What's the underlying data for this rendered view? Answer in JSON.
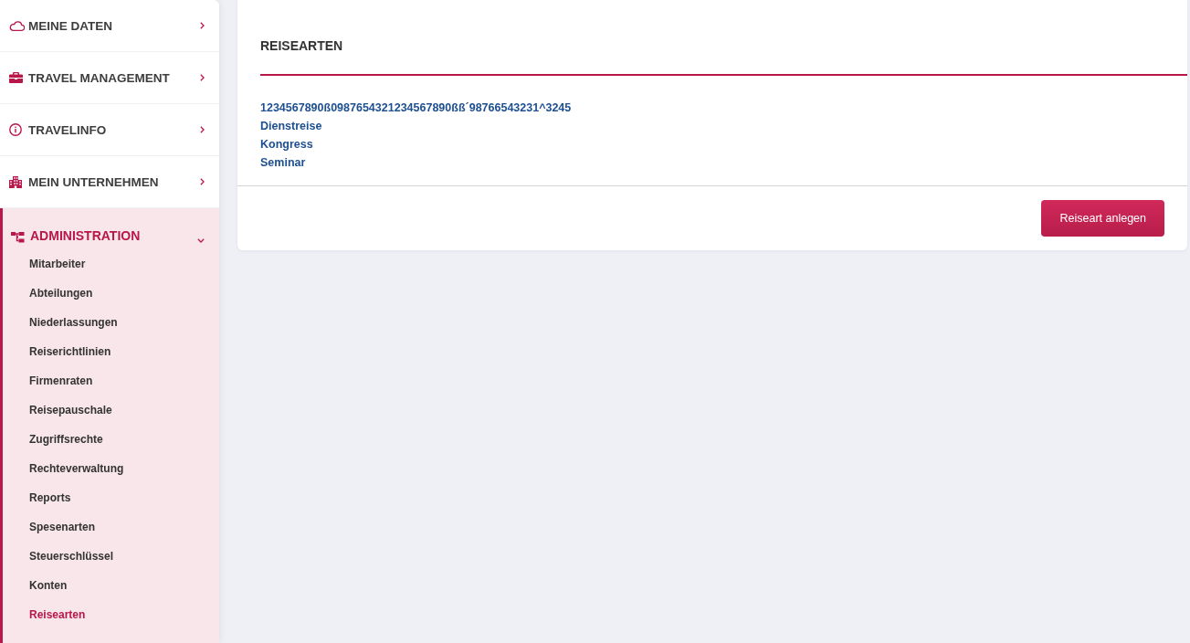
{
  "sidebar": {
    "items": [
      {
        "label": "MEINE DATEN",
        "expanded": false
      },
      {
        "label": "TRAVEL MANAGEMENT",
        "expanded": false
      },
      {
        "label": "TRAVELINFO",
        "expanded": false
      },
      {
        "label": "MEIN UNTERNEHMEN",
        "expanded": false
      },
      {
        "label": "ADMINISTRATION",
        "expanded": true,
        "children": [
          {
            "label": "Mitarbeiter",
            "selected": false
          },
          {
            "label": "Abteilungen",
            "selected": false
          },
          {
            "label": "Niederlassungen",
            "selected": false
          },
          {
            "label": "Reiserichtlinien",
            "selected": false
          },
          {
            "label": "Firmenraten",
            "selected": false
          },
          {
            "label": "Reisepauschale",
            "selected": false
          },
          {
            "label": "Zugriffsrechte",
            "selected": false
          },
          {
            "label": "Rechteverwaltung",
            "selected": false
          },
          {
            "label": "Reports",
            "selected": false
          },
          {
            "label": "Spesenarten",
            "selected": false
          },
          {
            "label": "Steuerschlüssel",
            "selected": false
          },
          {
            "label": "Konten",
            "selected": false
          },
          {
            "label": "Reisearten",
            "selected": true
          }
        ]
      }
    ]
  },
  "card": {
    "title": "REISEARTEN",
    "items": [
      "1234567890ß0987654321234567890ßß´98766543231^3245",
      "Dienstreise",
      "Kongress",
      "Seminar"
    ],
    "button": "Reiseart anlegen"
  }
}
